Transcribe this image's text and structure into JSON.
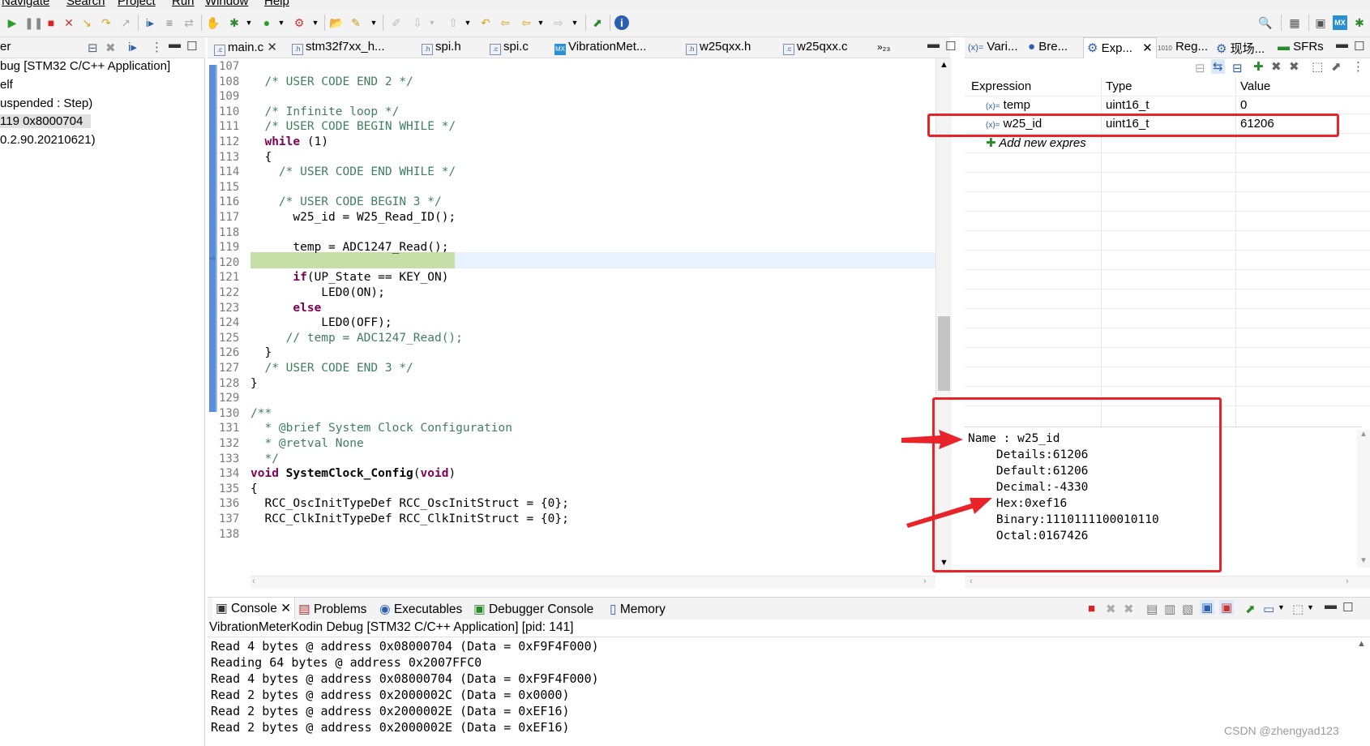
{
  "menu": [
    "Navigate",
    "Search",
    "Project",
    "Run",
    "Window",
    "Help"
  ],
  "left_panel": {
    "header": "er",
    "lines": [
      "bug [STM32 C/C++ Application]",
      "elf",
      "uspended : Step)",
      "119 0x8000704",
      "0.2.90.20210621)"
    ]
  },
  "editor_tabs": [
    "main.c",
    "stm32f7xx_h...",
    "spi.h",
    "spi.c",
    "VibrationMet...",
    "w25qxx.h",
    "w25qxx.c",
    "»₂₃"
  ],
  "editor": {
    "lines": [
      {
        "n": "107",
        "code": ""
      },
      {
        "n": "108",
        "code": "  /* USER CODE END 2 */"
      },
      {
        "n": "109",
        "code": ""
      },
      {
        "n": "110",
        "code": "  /* Infinite loop */"
      },
      {
        "n": "111",
        "code": "  /* USER CODE BEGIN WHILE */"
      },
      {
        "n": "112",
        "code": "  while (1)"
      },
      {
        "n": "113",
        "code": "  {"
      },
      {
        "n": "114",
        "code": "    /* USER CODE END WHILE */"
      },
      {
        "n": "115",
        "code": ""
      },
      {
        "n": "116",
        "code": "    /* USER CODE BEGIN 3 */"
      },
      {
        "n": "117",
        "code": "      w25_id = W25_Read_ID();"
      },
      {
        "n": "118",
        "code": ""
      },
      {
        "n": "119",
        "code": "      temp = ADC1247_Read();"
      },
      {
        "n": "120",
        "code": ""
      },
      {
        "n": "121",
        "code": "      if(UP_State == KEY_ON)"
      },
      {
        "n": "122",
        "code": "          LED0(ON);"
      },
      {
        "n": "123",
        "code": "      else"
      },
      {
        "n": "124",
        "code": "          LED0(OFF);"
      },
      {
        "n": "125",
        "code": "     // temp = ADC1247_Read();"
      },
      {
        "n": "126",
        "code": "  }"
      },
      {
        "n": "127",
        "code": "  /* USER CODE END 3 */"
      },
      {
        "n": "128",
        "code": "}"
      },
      {
        "n": "129",
        "code": ""
      },
      {
        "n": "130",
        "code": "/**"
      },
      {
        "n": "131",
        "code": "  * @brief System Clock Configuration"
      },
      {
        "n": "132",
        "code": "  * @retval None"
      },
      {
        "n": "133",
        "code": "  */"
      },
      {
        "n": "134",
        "code": "void SystemClock_Config(void)"
      },
      {
        "n": "135",
        "code": "{"
      },
      {
        "n": "136",
        "code": "  RCC_OscInitTypeDef RCC_OscInitStruct = {0};"
      },
      {
        "n": "137",
        "code": "  RCC_ClkInitTypeDef RCC_ClkInitStruct = {0};"
      },
      {
        "n": "138",
        "code": ""
      }
    ]
  },
  "right_tabs": [
    "Vari...",
    "Bre...",
    "Exp...",
    "Reg...",
    "现场...",
    "SFRs"
  ],
  "expressions": {
    "headers": [
      "Expression",
      "Type",
      "Value"
    ],
    "rows": [
      {
        "name": "temp",
        "type": "uint16_t",
        "value": "0"
      },
      {
        "name": "w25_id",
        "type": "uint16_t",
        "value": "61206"
      }
    ],
    "add_label": "Add new expres",
    "details": [
      "Name : w25_id",
      "    Details:61206",
      "    Default:61206",
      "    Decimal:-4330",
      "    Hex:0xef16",
      "    Binary:1110111100010110",
      "    Octal:0167426"
    ]
  },
  "console": {
    "tabs": [
      "Console",
      "Problems",
      "Executables",
      "Debugger Console",
      "Memory"
    ],
    "title": "VibrationMeterKodin Debug [STM32 C/C++ Application] [pid: 141]",
    "lines": [
      "Read 4 bytes @ address 0x08000704 (Data = 0xF9F4F000)",
      "Reading 64 bytes @ address 0x2007FFC0",
      "Read 4 bytes @ address 0x08000704 (Data = 0xF9F4F000)",
      "Read 2 bytes @ address 0x2000002C (Data = 0x0000)",
      "Read 2 bytes @ address 0x2000002E (Data = 0xEF16)",
      "Read 2 bytes @ address 0x2000002E (Data = 0xEF16)"
    ]
  },
  "watermark": "CSDN @zhengyad123",
  "colors": {
    "accent_red": "#e8232a",
    "comment": "#3f7f5f",
    "keyword": "#7f0055",
    "selection": "#cce4f7",
    "current_stmt": "#c6dfa9"
  }
}
